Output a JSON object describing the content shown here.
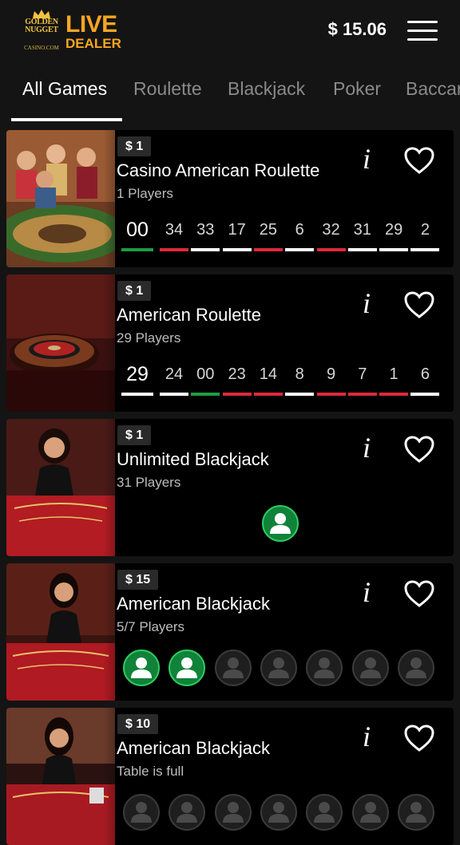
{
  "header": {
    "logo_brand_line1": "GOLDEN",
    "logo_brand_line2": "NUGGET",
    "logo_sub": "CASINO.COM",
    "logo_live": "LIVE",
    "logo_dealer": "DEALER",
    "balance": "$ 15.06",
    "menu_icon": "hamburger-menu-icon"
  },
  "tabs": [
    {
      "label": "All Games",
      "active": true
    },
    {
      "label": "Roulette",
      "active": false
    },
    {
      "label": "Blackjack",
      "active": false
    },
    {
      "label": "Poker",
      "active": false
    },
    {
      "label": "Baccarat",
      "active": false
    }
  ],
  "colors": {
    "accent_gold": "#f6a623",
    "roulette_green": "#1f9a43",
    "roulette_red": "#e0283a",
    "seat_green": "#11823a",
    "card_bg": "#000000",
    "page_bg": "#141414"
  },
  "games": [
    {
      "bet": "$ 1",
      "title": "Casino American Roulette",
      "subtitle": "1 Players",
      "info_icon": "info-icon",
      "fav_icon": "heart-outline-icon",
      "history": [
        {
          "n": "00",
          "c": "green"
        },
        {
          "n": "34",
          "c": "red"
        },
        {
          "n": "33",
          "c": "white"
        },
        {
          "n": "17",
          "c": "white"
        },
        {
          "n": "25",
          "c": "red"
        },
        {
          "n": "6",
          "c": "white"
        },
        {
          "n": "32",
          "c": "red"
        },
        {
          "n": "31",
          "c": "white"
        },
        {
          "n": "29",
          "c": "white"
        },
        {
          "n": "2",
          "c": "white"
        }
      ]
    },
    {
      "bet": "$ 1",
      "title": "American Roulette",
      "subtitle": "29 Players",
      "info_icon": "info-icon",
      "fav_icon": "heart-outline-icon",
      "history": [
        {
          "n": "29",
          "c": "white"
        },
        {
          "n": "24",
          "c": "white"
        },
        {
          "n": "00",
          "c": "green"
        },
        {
          "n": "23",
          "c": "red"
        },
        {
          "n": "14",
          "c": "red"
        },
        {
          "n": "8",
          "c": "white"
        },
        {
          "n": "9",
          "c": "red"
        },
        {
          "n": "7",
          "c": "red"
        },
        {
          "n": "1",
          "c": "red"
        },
        {
          "n": "6",
          "c": "white"
        }
      ]
    },
    {
      "bet": "$ 1",
      "title": "Unlimited Blackjack",
      "subtitle": "31 Players",
      "info_icon": "info-icon",
      "fav_icon": "heart-outline-icon",
      "seats": [
        "occupied"
      ]
    },
    {
      "bet": "$ 15",
      "title": "American Blackjack",
      "subtitle": "5/7 Players",
      "info_icon": "info-icon",
      "fav_icon": "heart-outline-icon",
      "seats": [
        "occupied",
        "occupied",
        "empty",
        "empty",
        "empty",
        "empty",
        "empty"
      ]
    },
    {
      "bet": "$ 10",
      "title": "American Blackjack",
      "subtitle": "Table is full",
      "info_icon": "info-icon",
      "fav_icon": "heart-outline-icon",
      "seats": [
        "empty",
        "empty",
        "empty",
        "empty",
        "empty",
        "empty",
        "empty"
      ]
    }
  ]
}
